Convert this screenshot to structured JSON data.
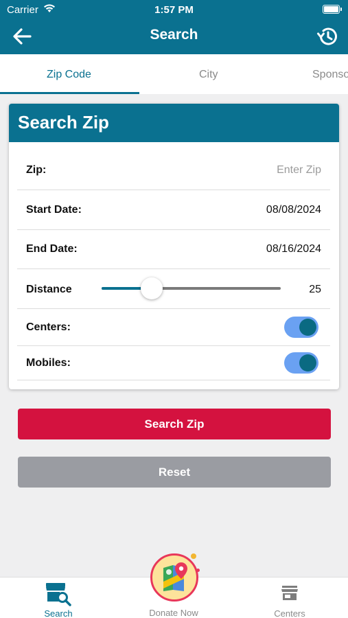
{
  "status_bar": {
    "carrier": "Carrier",
    "time": "1:57 PM"
  },
  "header": {
    "title": "Search"
  },
  "tabs": [
    {
      "label": "Zip Code",
      "active": true
    },
    {
      "label": "City",
      "active": false
    },
    {
      "label": "Sponso",
      "active": false
    }
  ],
  "card": {
    "title": "Search Zip",
    "zip": {
      "label": "Zip:",
      "placeholder": "Enter Zip",
      "value": ""
    },
    "start_date": {
      "label": "Start Date:",
      "value": "08/08/2024"
    },
    "end_date": {
      "label": "End Date:",
      "value": "08/16/2024"
    },
    "distance": {
      "label": "Distance",
      "value": "25",
      "slider_fraction": 0.28
    },
    "centers": {
      "label": "Centers:",
      "on": true
    },
    "mobiles": {
      "label": "Mobiles:",
      "on": true
    }
  },
  "buttons": {
    "search": "Search Zip",
    "reset": "Reset"
  },
  "bottom_nav": {
    "items": [
      {
        "label": "Search",
        "icon": "store-search-icon",
        "active": true
      },
      {
        "label": "Donate Now",
        "icon": "map-pin-icon",
        "active": false
      },
      {
        "label": "Centers",
        "icon": "storefront-icon",
        "active": false
      }
    ]
  },
  "colors": {
    "primary": "#0a7190",
    "accent_red": "#d4123f",
    "reset_gray": "#9a9ca2",
    "toggle_track": "#6aa1f2"
  }
}
